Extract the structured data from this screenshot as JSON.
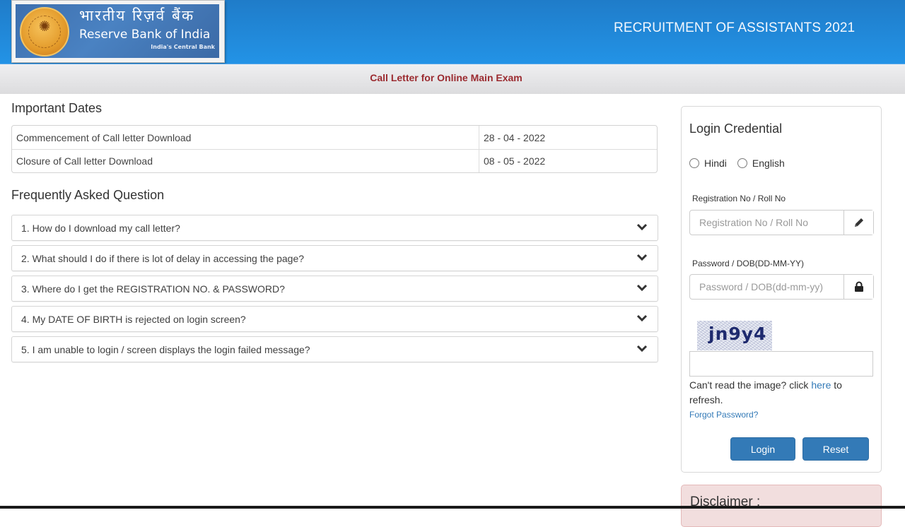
{
  "header": {
    "logo": {
      "hindi": "भारतीय रिज़र्व बैंक",
      "english": "Reserve Bank of India",
      "tagline": "India's Central Bank",
      "icon": "rbi-seal-icon"
    },
    "title": "RECRUITMENT OF ASSISTANTS 2021"
  },
  "subheader": {
    "title": "Call Letter for Online Main Exam"
  },
  "important_dates": {
    "title": "Important Dates",
    "rows": [
      {
        "label": "Commencement of Call letter Download",
        "value": "28 - 04 - 2022"
      },
      {
        "label": "Closure of Call letter Download",
        "value": "08 - 05 - 2022"
      }
    ]
  },
  "faq": {
    "title": "Frequently Asked Question",
    "items": [
      {
        "question": "1. How do I download my call letter?"
      },
      {
        "question": "2. What should I do if there is lot of delay in accessing the page?"
      },
      {
        "question": "3. Where do I get the REGISTRATION NO. & PASSWORD?"
      },
      {
        "question": "4. My DATE OF BIRTH is rejected on login screen?"
      },
      {
        "question": "5. I am unable to login / screen displays the login failed message?"
      }
    ],
    "expand_icon": "chevron-down-icon"
  },
  "login": {
    "title": "Login Credential",
    "languages": [
      "Hindi",
      "English"
    ],
    "registration": {
      "label": "Registration No / Roll No",
      "placeholder": "Registration No / Roll No",
      "value": "",
      "icon": "pencil-icon"
    },
    "password": {
      "label": "Password / DOB(DD-MM-YY)",
      "placeholder": "Password / DOB(dd-mm-yy)",
      "value": "",
      "icon": "lock-icon"
    },
    "captcha": {
      "text": "jn9y4",
      "input_value": "",
      "refresh_prefix": "Can't read the image? click ",
      "refresh_link": "here",
      "refresh_suffix": " to refresh."
    },
    "forgot_password": "Forgot Password?",
    "login_button": "Login",
    "reset_button": "Reset"
  },
  "disclaimer": {
    "title": "Disclaimer :"
  },
  "colors": {
    "header_blue": "#2393e6",
    "subtitle_red": "#9b2b30",
    "button_blue": "#337ab7",
    "link_blue": "#337ab7",
    "disclaimer_bg": "#f2dede"
  }
}
